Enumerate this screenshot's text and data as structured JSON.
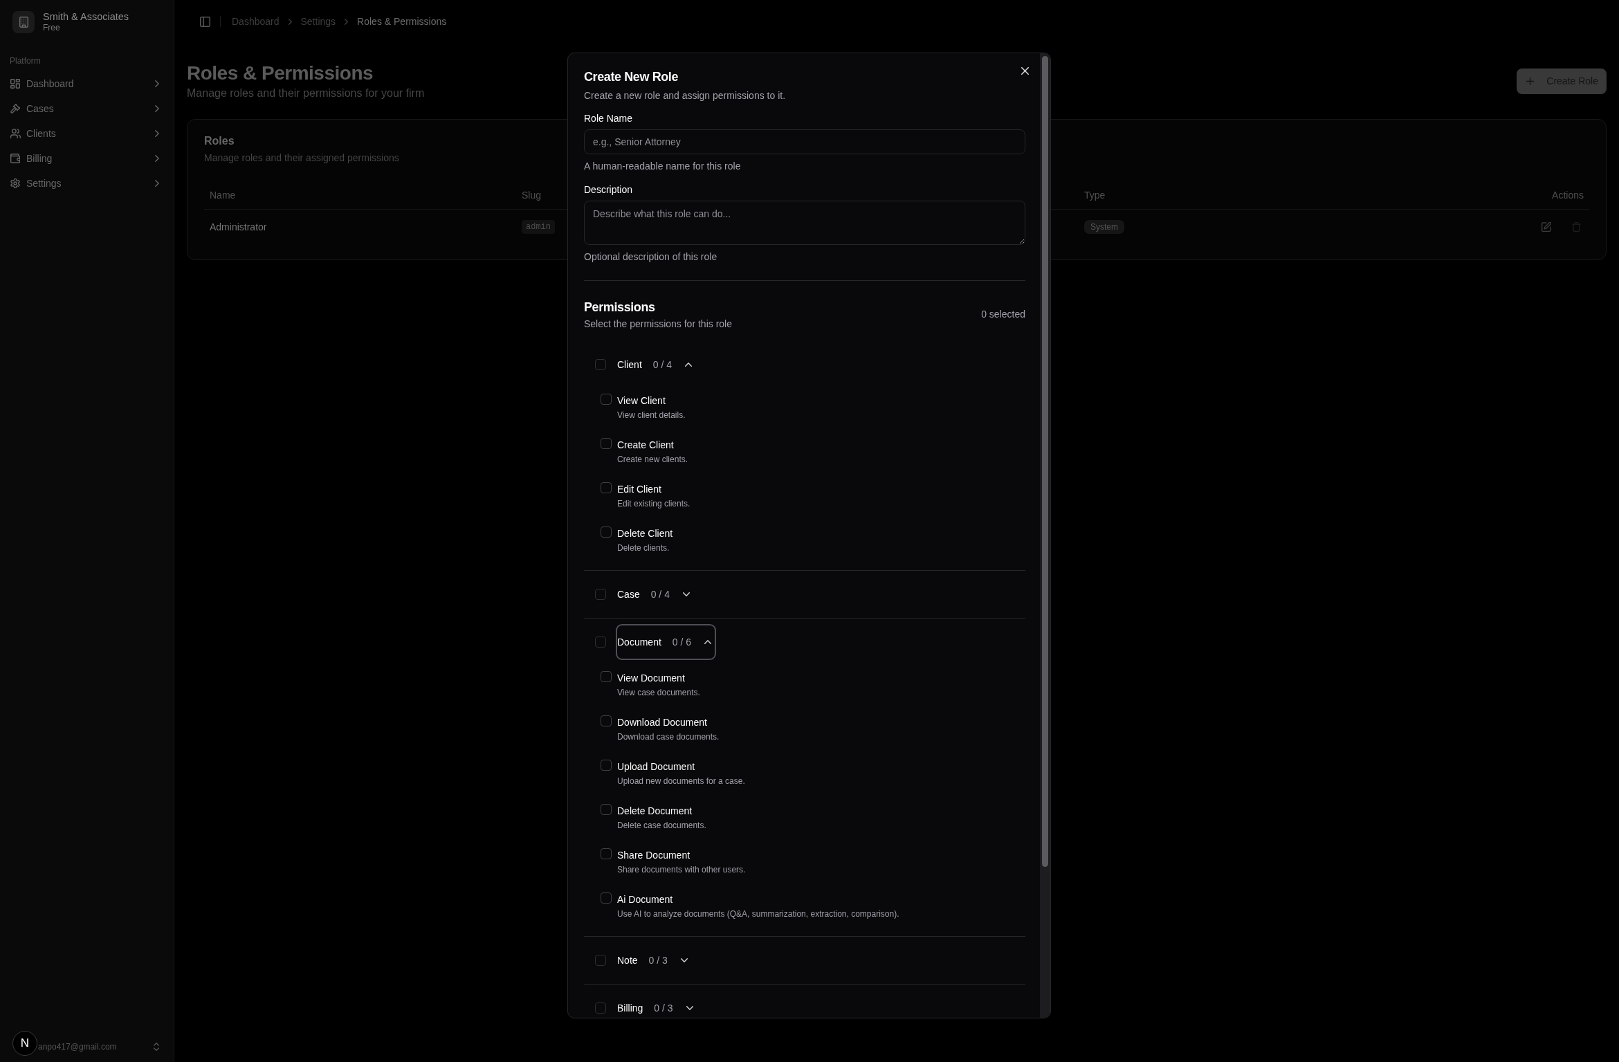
{
  "sidebar": {
    "workspace": {
      "name": "Smith & Associates",
      "plan": "Free"
    },
    "section_label": "Platform",
    "items": [
      {
        "label": "Dashboard",
        "expanded": false
      },
      {
        "label": "Cases",
        "expanded": false
      },
      {
        "label": "Clients",
        "expanded": false
      },
      {
        "label": "Billing",
        "expanded": false
      },
      {
        "label": "Settings",
        "expanded": false
      }
    ],
    "user": {
      "email": "anpo417@gmail.com"
    }
  },
  "dev_indicator": {
    "label": "N"
  },
  "breadcrumbs": [
    {
      "label": "Dashboard",
      "current": false
    },
    {
      "label": "Settings",
      "current": false
    },
    {
      "label": "Roles & Permissions",
      "current": true
    }
  ],
  "page": {
    "title": "Roles & Permissions",
    "subtitle": "Manage roles and their permissions for your firm",
    "primary_action": "Create Role"
  },
  "roles_card": {
    "title": "Roles",
    "description": "Manage roles and their assigned permissions",
    "table": {
      "columns": [
        "Name",
        "Slug",
        "Type",
        "Actions"
      ],
      "rows": [
        {
          "name": "Administrator",
          "slug": "admin",
          "type": "System"
        }
      ]
    }
  },
  "dialog": {
    "title": "Create New Role",
    "description": "Create a new role and assign permissions to it.",
    "fields": [
      {
        "kind": "input",
        "label": "Role Name",
        "placeholder": "e.g., Senior Attorney",
        "hint": "A human-readable name for this role"
      },
      {
        "kind": "textarea",
        "label": "Description",
        "placeholder": "Describe what this role can do...",
        "hint": "Optional description of this role"
      }
    ],
    "permissions": {
      "title": "Permissions",
      "subtitle": "Select the permissions for this role",
      "selected_count": "0 selected",
      "groups": [
        {
          "name": "Client",
          "count": "0 / 4",
          "checked": false,
          "expanded": true,
          "focused": false,
          "items": [
            {
              "title": "View Client",
              "description": "View client details.",
              "checked": false
            },
            {
              "title": "Create Client",
              "description": "Create new clients.",
              "checked": false
            },
            {
              "title": "Edit Client",
              "description": "Edit existing clients.",
              "checked": false
            },
            {
              "title": "Delete Client",
              "description": "Delete clients.",
              "checked": false
            }
          ]
        },
        {
          "name": "Case",
          "count": "0 / 4",
          "checked": false,
          "expanded": false,
          "focused": false
        },
        {
          "name": "Document",
          "count": "0 / 6",
          "checked": false,
          "expanded": true,
          "focused": true,
          "items": [
            {
              "title": "View Document",
              "description": "View case documents.",
              "checked": false
            },
            {
              "title": "Download Document",
              "description": "Download case documents.",
              "checked": false
            },
            {
              "title": "Upload Document",
              "description": "Upload new documents for a case.",
              "checked": false
            },
            {
              "title": "Delete Document",
              "description": "Delete case documents.",
              "checked": false
            },
            {
              "title": "Share Document",
              "description": "Share documents with other users.",
              "checked": false
            },
            {
              "title": "Ai Document",
              "description": "Use AI to analyze documents (Q&A, summarization, extraction, comparison).",
              "checked": false
            }
          ]
        },
        {
          "name": "Note",
          "count": "0 / 3",
          "checked": false,
          "expanded": false,
          "focused": false
        },
        {
          "name": "Billing",
          "count": "0 / 3",
          "checked": false,
          "expanded": false,
          "focused": false
        }
      ]
    }
  }
}
